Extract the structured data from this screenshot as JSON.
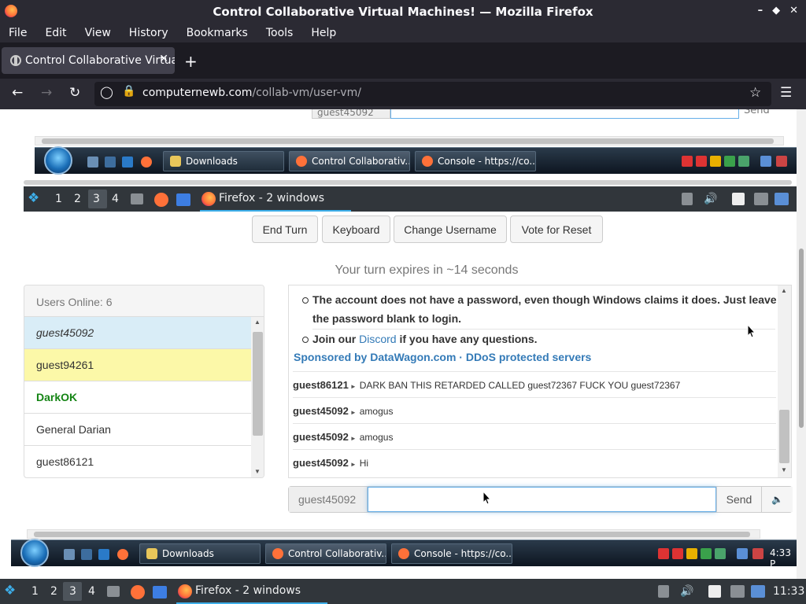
{
  "window": {
    "title": "Control Collaborative Virtual Machines! — Mozilla Firefox"
  },
  "menu": [
    "File",
    "Edit",
    "View",
    "History",
    "Bookmarks",
    "Tools",
    "Help"
  ],
  "tab": {
    "title": "Control Collaborative Virtual Machines!"
  },
  "url": {
    "domain": "computernewb.com",
    "path": "/collab-vm/user-vm/"
  },
  "vm": {
    "top_top_username": "guest45092",
    "top_top_send": "Send",
    "win_tasks": [
      "Downloads",
      "Control Collaborativ...",
      "Console - https://co..."
    ],
    "kde_desktops": [
      "1",
      "2",
      "3",
      "4"
    ],
    "kde_task": "Firefox - 2 windows",
    "clock": "4:33 P"
  },
  "buttons": [
    "End Turn",
    "Keyboard",
    "Change Username",
    "Vote for Reset"
  ],
  "turn_text": "Your turn expires in ~14 seconds",
  "users": {
    "header": "Users Online: 6",
    "list": [
      "guest45092",
      "guest94261",
      "DarkOK",
      "General Darian",
      "guest86121"
    ]
  },
  "chat": {
    "bullets": [
      "The account does not have a password, even though Windows claims it does. Just leave the password blank to login.",
      "Join our Discord if you have any questions."
    ],
    "bullet1_line1": "The account does not have a password, even though Windows claims it does. Just leave",
    "bullet1_line2": "the password blank to login.",
    "bullet2_pre": "Join our ",
    "bullet2_link": "Discord",
    "bullet2_post": " if you have any questions.",
    "sponsor": "Sponsored by DataWagon.com · DDoS protected servers",
    "messages": [
      {
        "user": "guest86121",
        "text": "DARK BAN THIS RETARDED CALLED guest72367 FUCK YOU guest72367"
      },
      {
        "user": "guest45092",
        "text": "amogus"
      },
      {
        "user": "guest45092",
        "text": "amogus"
      },
      {
        "user": "guest45092",
        "text": "Hi"
      }
    ]
  },
  "input": {
    "username": "guest45092",
    "value": "",
    "send": "Send"
  },
  "host_panel": {
    "desktops": [
      "1",
      "2",
      "3",
      "4"
    ],
    "task": "Firefox - 2 windows",
    "clock": "11:33"
  },
  "colors": {
    "accent": "#3daee9",
    "selected_user_bg": "#d9edf7",
    "yellow_user_bg": "#fcf8a8",
    "admin_green": "#148414",
    "link": "#337ab7"
  }
}
